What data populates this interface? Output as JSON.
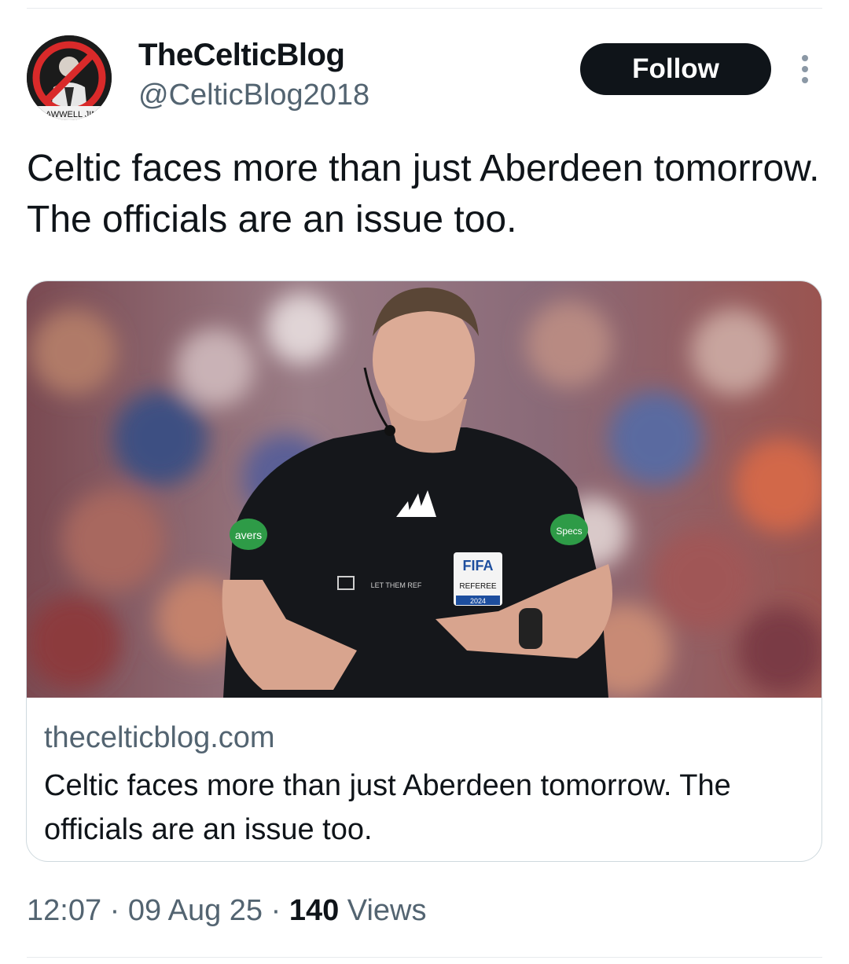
{
  "author": {
    "display_name": "TheCelticBlog",
    "handle": "@CelticBlog2018",
    "avatar_banner_text": "LAWWELL JIN"
  },
  "actions": {
    "follow_label": "Follow"
  },
  "tweet": {
    "text": "Celtic faces more than just Aberdeen tomorrow. The officials are an issue too."
  },
  "card": {
    "domain": "thecelticblog.com",
    "title": "Celtic faces more than just Aberdeen tomorrow. The officials are an issue too.",
    "image_badges": {
      "fifa": "FIFA",
      "referee": "REFEREE",
      "year": "2024",
      "let_them_ref": "LET THEM REF",
      "sleeve_left": "avers",
      "sleeve_right": "Specs"
    }
  },
  "meta": {
    "time": "12:07",
    "separator": "·",
    "date": "09 Aug 25",
    "views_count": "140",
    "views_label": "Views"
  },
  "colors": {
    "text_primary": "#0f1419",
    "text_secondary": "#536471",
    "border": "#cfd9de",
    "follow_bg": "#0f1419",
    "sponsor_green": "#2e9b47",
    "no_sign_red": "#d92a2a"
  }
}
